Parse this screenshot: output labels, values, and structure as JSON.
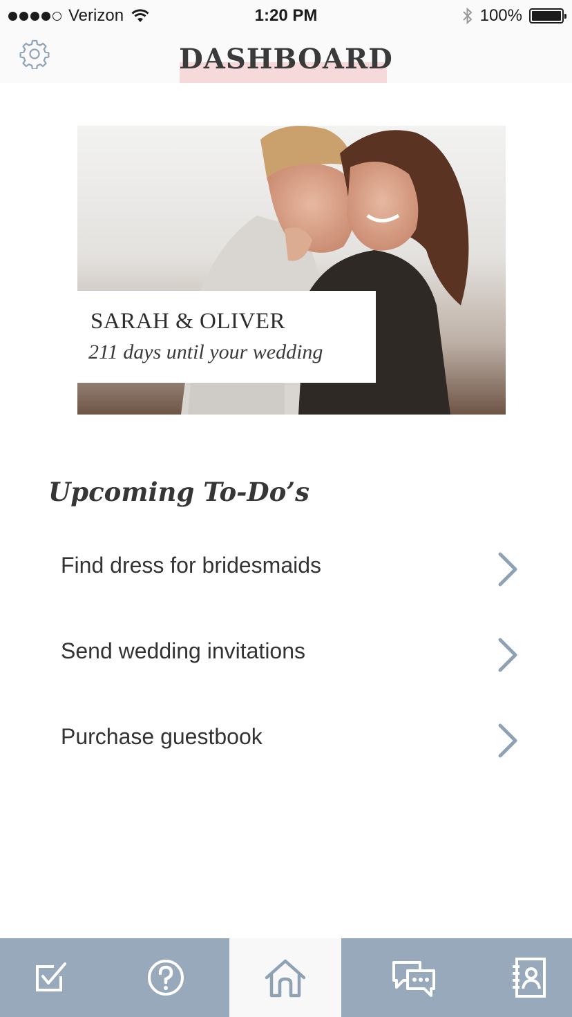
{
  "status_bar": {
    "carrier": "Verizon",
    "time": "1:20 PM",
    "battery": "100%",
    "signal_icon": "signal-dots-icon",
    "wifi_icon": "wifi-icon",
    "bluetooth_icon": "bluetooth-icon",
    "battery_icon": "battery-icon"
  },
  "header": {
    "title": "DASHBOARD",
    "settings_icon": "gear-icon",
    "highlight_color": "#f6d9da"
  },
  "hero": {
    "image": "couple-photo",
    "names": "SARAH & OLIVER",
    "countdown": "211 days until your wedding"
  },
  "todos": {
    "heading": "Upcoming To-Do’s",
    "items": [
      {
        "label": "Find dress for bridesmaids",
        "icon": "chevron-right-icon"
      },
      {
        "label": "Send wedding invitations",
        "icon": "chevron-right-icon"
      },
      {
        "label": "Purchase guestbook",
        "icon": "chevron-right-icon"
      }
    ]
  },
  "tab_bar": {
    "background": "#97a9bb",
    "tabs": [
      {
        "icon": "checklist-icon",
        "active": false
      },
      {
        "icon": "help-icon",
        "active": false
      },
      {
        "icon": "home-icon",
        "active": true
      },
      {
        "icon": "chat-icon",
        "active": false
      },
      {
        "icon": "contacts-icon",
        "active": false
      }
    ]
  }
}
